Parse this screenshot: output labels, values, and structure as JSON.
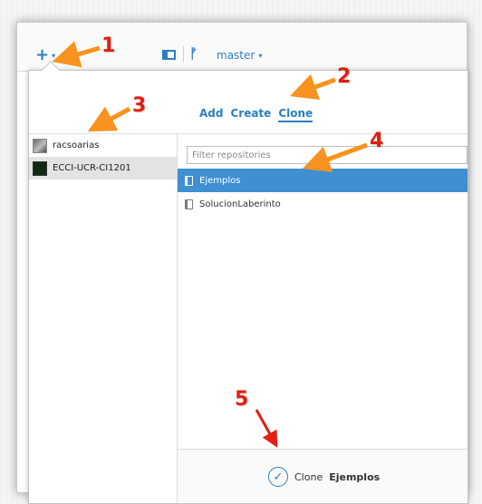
{
  "toolbar": {
    "add_icon": "plus-icon",
    "add_caret": "▾",
    "branch": "master",
    "branch_caret": "▾"
  },
  "popover": {
    "tabs": [
      {
        "label": "Add"
      },
      {
        "label": "Create"
      },
      {
        "label": "Clone",
        "active": true
      }
    ],
    "accounts": [
      {
        "name": "racsoarias"
      },
      {
        "name": "ECCI-UCR-CI1201",
        "selected": true
      }
    ],
    "filter_placeholder": "Filter repositories",
    "repos": [
      {
        "name": "Ejemplos",
        "selected": true
      },
      {
        "name": "SolucionLaberinto"
      }
    ],
    "clone_button": {
      "prefix": "Clone",
      "repo": "Ejemplos"
    }
  },
  "annotations": {
    "numbers": [
      "1",
      "2",
      "3",
      "4",
      "5"
    ],
    "color": "#e11f12",
    "arrow_color": "#f7931e"
  },
  "colors": {
    "accent": "#2a7fc0",
    "selection": "#3f8fd2"
  }
}
